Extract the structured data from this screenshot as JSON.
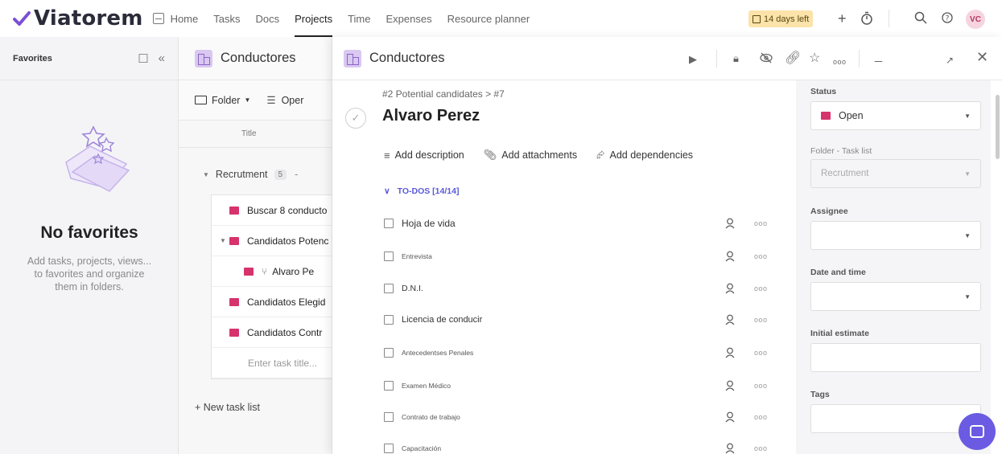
{
  "topbar": {
    "brand": "Viatorem",
    "nav": [
      "Home",
      "Tasks",
      "Docs",
      "Projects",
      "Time",
      "Expenses",
      "Resource planner"
    ],
    "active_nav": "Projects",
    "trial": "14 days left",
    "avatar": "VC"
  },
  "favorites": {
    "title": "Favorites",
    "empty_title": "No favorites",
    "empty_text": "Add tasks, projects, views... to favorites and organize them in folders."
  },
  "project": {
    "title": "Conductores",
    "toolbar": {
      "folder": "Folder",
      "open": "Oper"
    },
    "column_title": "Title",
    "group": {
      "name": "Recrutment",
      "count": "5"
    },
    "tasks": [
      "Buscar 8 conducto",
      "Candidatos Potenc",
      "Alvaro Pe",
      "Candidatos Elegid",
      "Candidatos Contr"
    ],
    "enter_task": "Enter task title...",
    "new_task_list": "+ New task list"
  },
  "detail": {
    "project_title": "Conductores",
    "breadcrumb": "#2 Potential candidates  >  #7",
    "task_name": "Alvaro Perez",
    "actions": [
      "Add description",
      "Add attachments",
      "Add dependencies"
    ],
    "todos_title": "TO-DOS [14/14]",
    "todos": [
      "Hoja de vida",
      "Entrevista",
      "D.N.I.",
      "Licencia de conducir",
      "Antecedentses Penales",
      "Examen Médico",
      "Contrato de trabajo",
      "Capacitación"
    ]
  },
  "props": {
    "status_label": "Status",
    "status_value": "Open",
    "status_color": "#d6336c",
    "folder_label": "Folder - Task list",
    "folder_value": "Recrutment",
    "assignee_label": "Assignee",
    "date_label": "Date and time",
    "estimate_label": "Initial estimate",
    "tags_label": "Tags"
  },
  "colors": {
    "accent": "#6a5be2",
    "brand_check": "#7b4fd6",
    "task_square": "#d6336c"
  }
}
